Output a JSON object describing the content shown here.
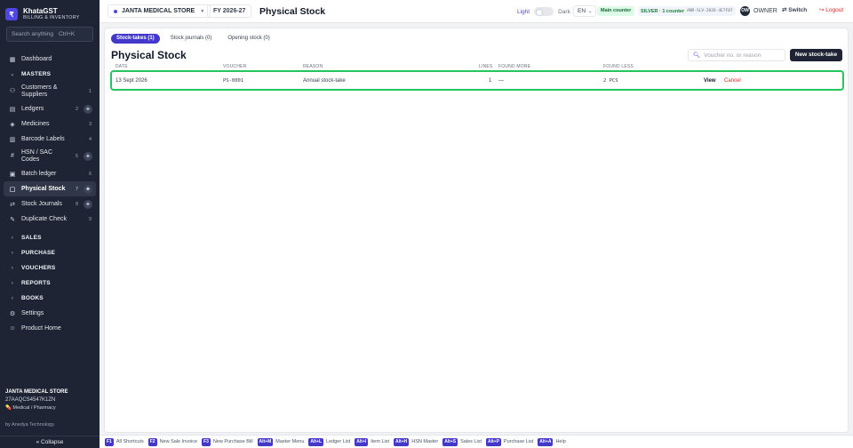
{
  "brand": {
    "logo": "₹",
    "name": "KhataGST",
    "subtitle": "BILLING & INVENTORY"
  },
  "sidebar": {
    "search_placeholder": "Search anything",
    "search_shortcut": "Ctrl+K",
    "items": [
      {
        "label": "Dashboard",
        "icon": "grid-icon",
        "count": ""
      },
      {
        "label": "MASTERS",
        "section": true,
        "expanded": true
      },
      {
        "label": "Customers & Suppliers",
        "icon": "people-icon",
        "count": "1"
      },
      {
        "label": "Ledgers",
        "icon": "ledger-icon",
        "count": "2"
      },
      {
        "label": "Medicines",
        "icon": "pill-icon",
        "count": "3"
      },
      {
        "label": "Barcode Labels",
        "icon": "barcode-icon",
        "count": "4"
      },
      {
        "label": "HSN / SAC Codes",
        "icon": "hash-icon",
        "count": "5"
      },
      {
        "label": "Batch ledger",
        "icon": "batch-icon",
        "count": "6"
      },
      {
        "label": "Physical Stock",
        "icon": "clipboard-icon",
        "count": "7",
        "active": true
      },
      {
        "label": "Stock Journals",
        "icon": "shuffle-icon",
        "count": "8"
      },
      {
        "label": "Duplicate Check",
        "icon": "pen-icon",
        "count": "9"
      },
      {
        "label": "SALES",
        "section": true
      },
      {
        "label": "PURCHASE",
        "section": true
      },
      {
        "label": "VOUCHERS",
        "section": true
      },
      {
        "label": "REPORTS",
        "section": true
      },
      {
        "label": "BOOKS",
        "section": true
      },
      {
        "label": "Settings",
        "icon": "gear-icon"
      },
      {
        "label": "Product Home",
        "icon": "user-icon"
      }
    ],
    "store_name": "JANTA MEDICAL STORE",
    "store_gstin": "27AAQCS4547K1ZN",
    "store_type": "Medical / Pharmacy",
    "by_line": "by Anedya Technology",
    "collapse_label": "« Collapse"
  },
  "topbar": {
    "store": "JANTA MEDICAL STORE",
    "fy": "FY 2026-27",
    "title": "Physical Stock",
    "theme_light": "Light",
    "theme_dark": "Dark",
    "language": "EN",
    "counter": "Main counter",
    "plan": "SILVER · 1 counter",
    "license": "ANR-SLV-2026-4E7F87",
    "avatar": "OW",
    "user": "OWNER",
    "switch": "Switch",
    "logout": "Logout"
  },
  "main": {
    "tabs": [
      {
        "label": "Stock-takes (1)",
        "active": true
      },
      {
        "label": "Stock journals (0)"
      },
      {
        "label": "Opening stock (0)"
      }
    ],
    "title": "Physical Stock",
    "search_placeholder": "Voucher no. or reason",
    "new_button": "New stock-take",
    "columns": [
      "DATE",
      "VOUCHER",
      "REASON",
      "LINES",
      "FOUND MORE",
      "FOUND LESS"
    ],
    "rows": [
      {
        "date": "13 Sept 2026",
        "voucher": "PS-0001",
        "reason": "Annual stock-take",
        "lines": "1",
        "found_more": "—",
        "found_less": "2 PCS",
        "view": "View",
        "cancel": "Cancel"
      }
    ]
  },
  "footer": {
    "shortcuts": [
      {
        "key": "F1",
        "label": "All Shortcuts"
      },
      {
        "key": "F2",
        "label": "New Sale Invoice"
      },
      {
        "key": "F3",
        "label": "New Purchase Bill"
      },
      {
        "key": "Alt+M",
        "label": "Master Menu"
      },
      {
        "key": "Alt+L",
        "label": "Ledger List"
      },
      {
        "key": "Alt+I",
        "label": "Item List"
      },
      {
        "key": "Alt+H",
        "label": "HSN Master"
      },
      {
        "key": "Alt+S",
        "label": "Sales List"
      },
      {
        "key": "Alt+P",
        "label": "Purchase List"
      },
      {
        "key": "Alt+A",
        "label": "Help"
      }
    ]
  }
}
